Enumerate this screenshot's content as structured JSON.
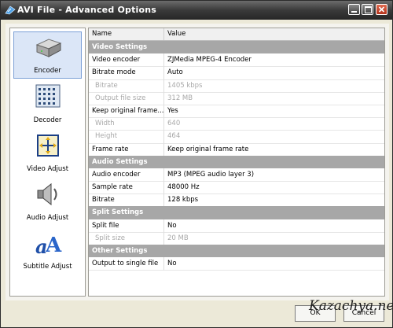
{
  "window": {
    "title": "AVI File - Advanced Options"
  },
  "nav": {
    "items": [
      {
        "label": "Encoder",
        "icon": "encoder-icon"
      },
      {
        "label": "Decoder",
        "icon": "decoder-icon"
      },
      {
        "label": "Video Adjust",
        "icon": "video-adjust-icon"
      },
      {
        "label": "Audio Adjust",
        "icon": "audio-adjust-icon"
      },
      {
        "label": "Subtitle Adjust",
        "icon": "subtitle-adjust-icon"
      }
    ],
    "active_index": 0
  },
  "grid": {
    "columns": {
      "name": "Name",
      "value": "Value"
    },
    "rows": [
      {
        "type": "section",
        "name": "Video Settings"
      },
      {
        "type": "row",
        "name": "Video encoder",
        "value": "ZJMedia MPEG-4 Encoder"
      },
      {
        "type": "row",
        "name": "Bitrate mode",
        "value": "Auto"
      },
      {
        "type": "disabled",
        "name": "Bitrate",
        "value": "1405 kbps"
      },
      {
        "type": "disabled",
        "name": "Output file size",
        "value": "312 MB"
      },
      {
        "type": "row",
        "name": "Keep original frame...",
        "value": "Yes"
      },
      {
        "type": "disabled",
        "name": "Width",
        "value": "640"
      },
      {
        "type": "disabled",
        "name": "Height",
        "value": "464"
      },
      {
        "type": "row",
        "name": "Frame rate",
        "value": "Keep original frame rate"
      },
      {
        "type": "section",
        "name": "Audio Settings"
      },
      {
        "type": "row",
        "name": "Audio encoder",
        "value": "MP3 (MPEG audio layer 3)"
      },
      {
        "type": "row",
        "name": "Sample rate",
        "value": "48000 Hz"
      },
      {
        "type": "row",
        "name": "Bitrate",
        "value": "128 kbps"
      },
      {
        "type": "section",
        "name": "Split Settings"
      },
      {
        "type": "row",
        "name": "Split file",
        "value": "No"
      },
      {
        "type": "disabled",
        "name": "Split size",
        "value": "20 MB"
      },
      {
        "type": "section",
        "name": "Other Settings"
      },
      {
        "type": "row",
        "name": "Output to single file",
        "value": "No"
      }
    ]
  },
  "buttons": {
    "ok": "OK",
    "cancel": "Cancel"
  },
  "watermark": "Kazachya.net"
}
